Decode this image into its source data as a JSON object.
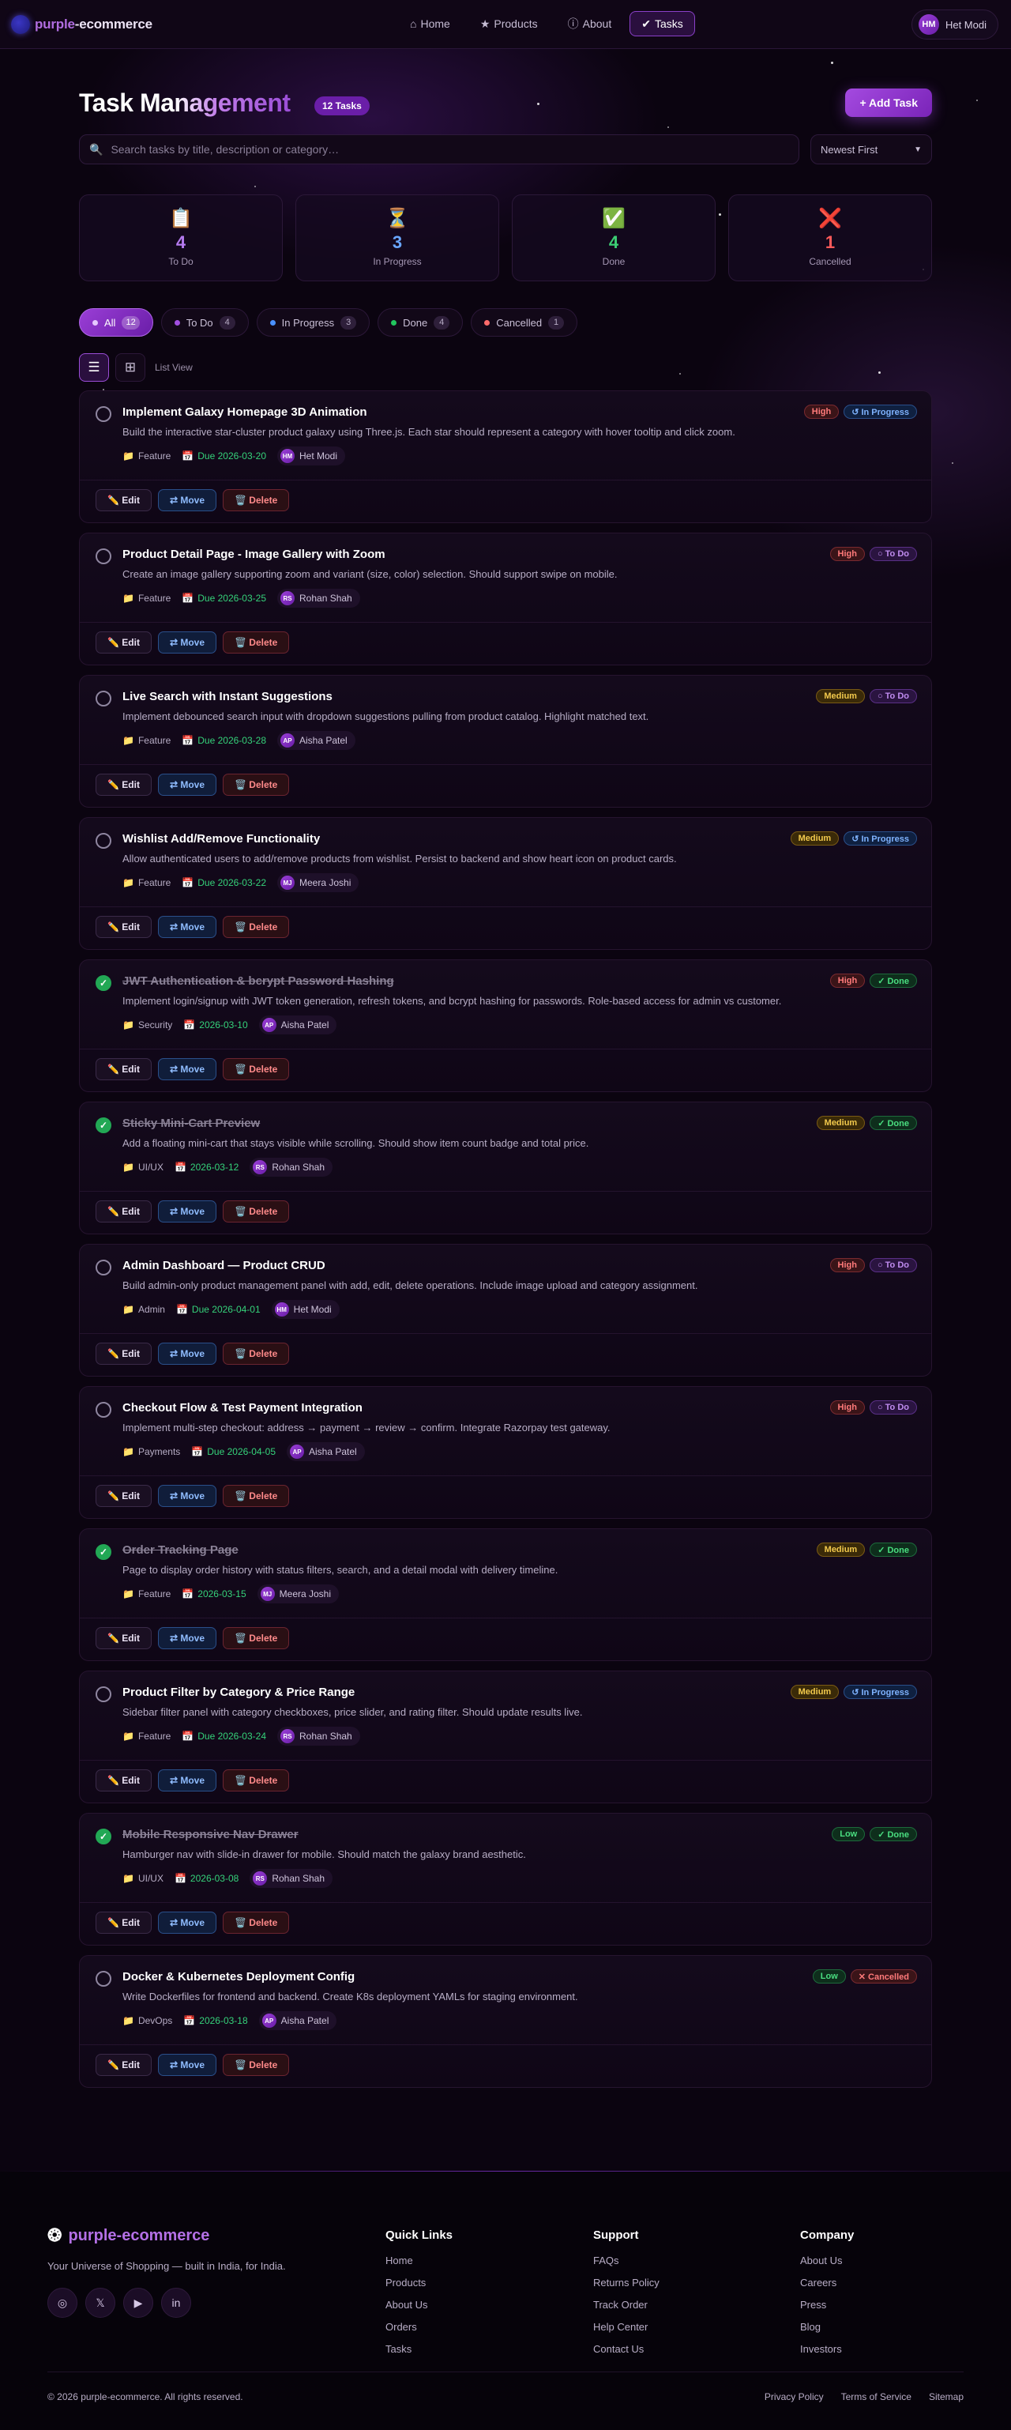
{
  "header": {
    "brand_a": "purple",
    "brand_b": "-ecommerce",
    "nav": [
      {
        "icon": "⌂",
        "label": "Home"
      },
      {
        "icon": "★",
        "label": "Products"
      },
      {
        "icon": "ⓘ",
        "label": "About"
      },
      {
        "icon": "✔",
        "label": "Tasks"
      }
    ],
    "user_initials": "HM",
    "user_name": "Het Modi"
  },
  "page": {
    "title": "Task Management",
    "task_count": "12 Tasks",
    "add_label": "+  Add Task",
    "search_placeholder": "Search tasks by title, description or category…",
    "sort_value": "Newest First"
  },
  "stats": [
    {
      "icon": "📋",
      "value": "4",
      "label": "To Do",
      "color": "#b57bef"
    },
    {
      "icon": "⏳",
      "value": "3",
      "label": "In Progress",
      "color": "#6aa7ff"
    },
    {
      "icon": "✅",
      "value": "4",
      "label": "Done",
      "color": "#3ccf74"
    },
    {
      "icon": "❌",
      "value": "1",
      "label": "Cancelled",
      "color": "#ff5a5a"
    }
  ],
  "filters": [
    {
      "label": "All",
      "count": "12",
      "dot": "#e6c8ff"
    },
    {
      "label": "To Do",
      "count": "4",
      "dot": "#a14fe0"
    },
    {
      "label": "In Progress",
      "count": "3",
      "dot": "#4a90ff"
    },
    {
      "label": "Done",
      "count": "4",
      "dot": "#22c55e"
    },
    {
      "label": "Cancelled",
      "count": "1",
      "dot": "#ff6b6b"
    }
  ],
  "view_label": "List View",
  "actions": {
    "edit": "✏️ Edit",
    "move": "⇄ Move",
    "delete": "🗑️ Delete"
  },
  "tasks": [
    {
      "title": "Implement Galaxy Homepage 3D Animation",
      "desc": "Build the interactive star-cluster product galaxy using Three.js. Each star should represent a category with hover tooltip and click zoom.",
      "category": "Feature",
      "due": "Due 2026-03-20",
      "initials": "HM",
      "assignee": "Het Modi",
      "priority": "High",
      "status": "↺ In Progress",
      "done": false
    },
    {
      "title": "Product Detail Page - Image Gallery with Zoom",
      "desc": "Create an image gallery supporting zoom and variant (size, color) selection. Should support swipe on mobile.",
      "category": "Feature",
      "due": "Due 2026-03-25",
      "initials": "RS",
      "assignee": "Rohan Shah",
      "priority": "High",
      "status": "○ To Do",
      "done": false
    },
    {
      "title": "Live Search with Instant Suggestions",
      "desc": "Implement debounced search input with dropdown suggestions pulling from product catalog. Highlight matched text.",
      "category": "Feature",
      "due": "Due 2026-03-28",
      "initials": "AP",
      "assignee": "Aisha Patel",
      "priority": "Medium",
      "status": "○ To Do",
      "done": false
    },
    {
      "title": "Wishlist Add/Remove Functionality",
      "desc": "Allow authenticated users to add/remove products from wishlist. Persist to backend and show heart icon on product cards.",
      "category": "Feature",
      "due": "Due 2026-03-22",
      "initials": "MJ",
      "assignee": "Meera Joshi",
      "priority": "Medium",
      "status": "↺ In Progress",
      "done": false
    },
    {
      "title": "JWT Authentication & bcrypt Password Hashing",
      "desc": "Implement login/signup with JWT token generation, refresh tokens, and bcrypt hashing for passwords. Role-based access for admin vs customer.",
      "category": "Security",
      "due": "2026-03-10",
      "initials": "AP",
      "assignee": "Aisha Patel",
      "priority": "High",
      "status": "✓ Done",
      "done": true
    },
    {
      "title": "Sticky Mini-Cart Preview",
      "desc": "Add a floating mini-cart that stays visible while scrolling. Should show item count badge and total price.",
      "category": "UI/UX",
      "due": "2026-03-12",
      "initials": "RS",
      "assignee": "Rohan Shah",
      "priority": "Medium",
      "status": "✓ Done",
      "done": true
    },
    {
      "title": "Admin Dashboard — Product CRUD",
      "desc": "Build admin-only product management panel with add, edit, delete operations. Include image upload and category assignment.",
      "category": "Admin",
      "due": "Due 2026-04-01",
      "initials": "HM",
      "assignee": "Het Modi",
      "priority": "High",
      "status": "○ To Do",
      "done": false
    },
    {
      "title": "Checkout Flow & Test Payment Integration",
      "desc": "Implement multi-step checkout: address → payment → review → confirm. Integrate Razorpay test gateway.",
      "category": "Payments",
      "due": "Due 2026-04-05",
      "initials": "AP",
      "assignee": "Aisha Patel",
      "priority": "High",
      "status": "○ To Do",
      "done": false
    },
    {
      "title": "Order Tracking Page",
      "desc": "Page to display order history with status filters, search, and a detail modal with delivery timeline.",
      "category": "Feature",
      "due": "2026-03-15",
      "initials": "MJ",
      "assignee": "Meera Joshi",
      "priority": "Medium",
      "status": "✓ Done",
      "done": true
    },
    {
      "title": "Product Filter by Category & Price Range",
      "desc": "Sidebar filter panel with category checkboxes, price slider, and rating filter. Should update results live.",
      "category": "Feature",
      "due": "Due 2026-03-24",
      "initials": "RS",
      "assignee": "Rohan Shah",
      "priority": "Medium",
      "status": "↺ In Progress",
      "done": false
    },
    {
      "title": "Mobile Responsive Nav Drawer",
      "desc": "Hamburger nav with slide-in drawer for mobile. Should match the galaxy brand aesthetic.",
      "category": "UI/UX",
      "due": "2026-03-08",
      "initials": "RS",
      "assignee": "Rohan Shah",
      "priority": "Low",
      "status": "✓ Done",
      "done": true
    },
    {
      "title": "Docker & Kubernetes Deployment Config",
      "desc": "Write Dockerfiles for frontend and backend. Create K8s deployment YAMLs for staging environment.",
      "category": "DevOps",
      "due": "2026-03-18",
      "initials": "AP",
      "assignee": "Aisha Patel",
      "priority": "Low",
      "status": "✕ Cancelled",
      "done": false
    }
  ],
  "footer": {
    "brand": "purple-ecommerce",
    "tagline": "Your Universe of Shopping — built in India, for India.",
    "socials": [
      "instagram-icon",
      "x-icon",
      "youtube-icon",
      "linkedin-icon"
    ],
    "columns": [
      {
        "title": "Quick Links",
        "links": [
          "Home",
          "Products",
          "About Us",
          "Orders",
          "Tasks"
        ]
      },
      {
        "title": "Support",
        "links": [
          "FAQs",
          "Returns Policy",
          "Track Order",
          "Help Center",
          "Contact Us"
        ]
      },
      {
        "title": "Company",
        "links": [
          "About Us",
          "Careers",
          "Press",
          "Blog",
          "Investors"
        ]
      }
    ],
    "copyright": "© 2026 purple-ecommerce. All rights reserved.",
    "bottom_links": [
      "Privacy Policy",
      "Terms of Service",
      "Sitemap"
    ]
  }
}
